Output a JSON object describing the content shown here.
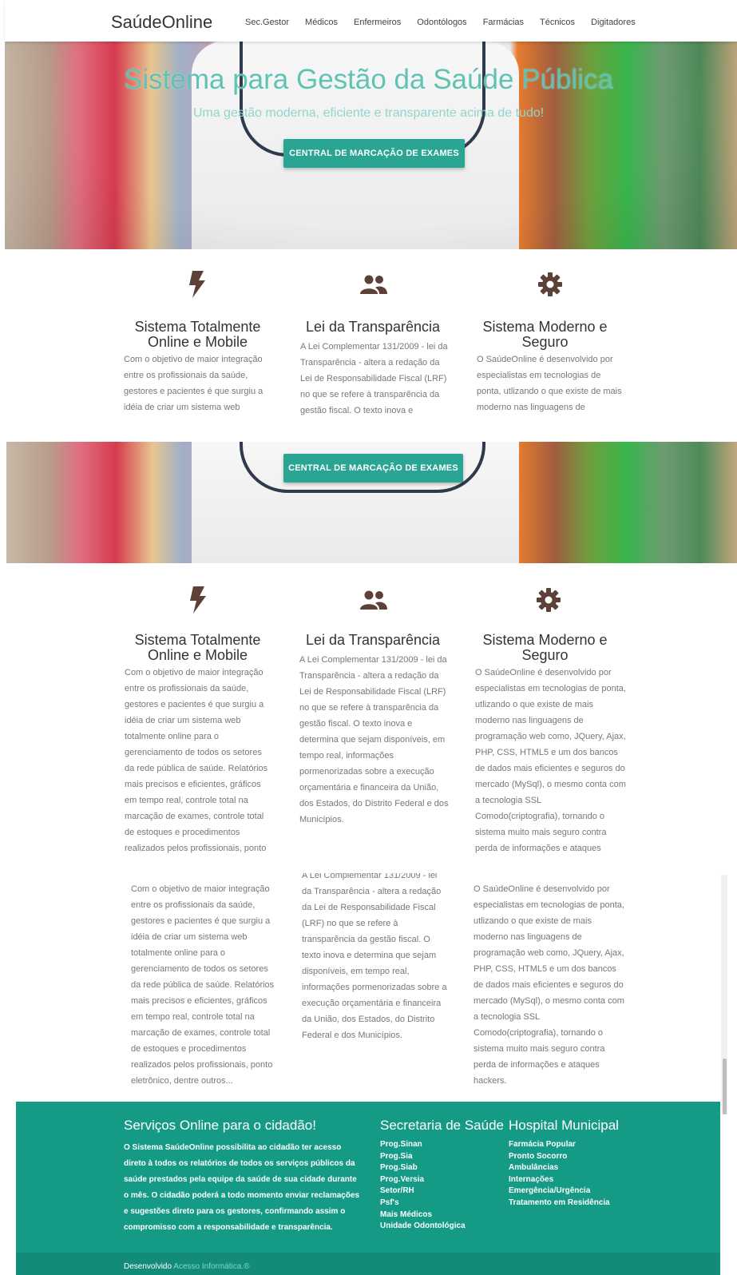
{
  "nav": {
    "brand": "SaúdeOnline",
    "links": [
      "Sec.Gestor",
      "Médicos",
      "Enfermeiros",
      "Odontólogos",
      "Farmácias",
      "Técnicos",
      "Digitadores"
    ]
  },
  "hero": {
    "title": "Sistema para Gestão da Saúde Pública",
    "subtitle": "Uma gestão moderna, eficiente e transparente acima de tudo!",
    "button": "CENTRAL DE MARCAÇÃO DE EXAMES"
  },
  "features": [
    {
      "icon": "bolt-icon",
      "title_l1": "Sistema Totalmente",
      "title_l2": "Online e Mobile",
      "text": "Com o objetivo de maior integração entre os profissionais da saúde, gestores e pacientes é que surgiu a idéia de criar um sistema web totalmente online para o gerenciamento de todos os setores da rede pública de saúde. Relatórios mais precisos e eficientes, gráficos em tempo real, controle total na marcação de exames, controle total de estoques e procedimentos realizados pelos profissionais, ponto eletrônico, dentre outros..."
    },
    {
      "icon": "people-icon",
      "title_l1": "Lei da Transparência",
      "title_l2": "",
      "text": "A Lei Complementar 131/2009 - lei da Transparência - altera a redação da Lei de Responsabilidade Fiscal (LRF) no que se refere à transparência da gestão fiscal. O texto inova e determina que sejam disponíveis, em tempo real, informações pormenorizadas sobre a execução orçamentária e financeira da União, dos Estados, do Distrito Federal e dos Municípios."
    },
    {
      "icon": "gear-icon",
      "title_l1": "Sistema Moderno e",
      "title_l2": "Seguro",
      "text": "O SaúdeOnline é desenvolvido por especialistas em tecnologias de ponta, utlizando o que existe de mais moderno nas linguagens de programação web como, JQuery, Ajax, PHP, CSS, HTML5 e um dos bancos de dados mais eficientes e seguros do mercado (MySql), o mesmo conta com a tecnologia SSL Comodo(criptografia), tornando o sistema muito mais seguro contra perda de informações e ataques hackers."
    }
  ],
  "footer": {
    "col1_title": "Serviços Online para o cidadão!",
    "col1_text": "O Sistema SaúdeOnline possibilita ao cidadão ter acesso direto à todos os relatórios de todos os serviços públicos da saúde prestados pela equipe da saúde de sua cidade durante o mês. O cidadão poderá a todo momento enviar reclamações e sugestões direto para os gestores, confirmando assim o compromisso com a responsabilidade e transparência.",
    "col2_title": "Secretaria de Saúde",
    "col2_items": [
      "Prog.Sinan",
      "Prog.Sia",
      "Prog.Siab",
      "Prog.Versia",
      "Setor/RH",
      "Psf's",
      "Mais Médicos",
      "Unidade Odontológica"
    ],
    "col3_title": "Hospital Municipal",
    "col3_items": [
      "Farmácia Popular",
      "Pronto Socorro",
      "Ambulâncias",
      "Internações",
      "Emergência/Urgência",
      "Tratamento em Residência"
    ],
    "dev_prefix": "Desenvolvido",
    "dev_link": "Acesso Informática.®"
  },
  "colors": {
    "accent": "#2aa594",
    "footer": "#159a86",
    "hero_title": "#5fc3b3",
    "icon": "#5d4037"
  }
}
